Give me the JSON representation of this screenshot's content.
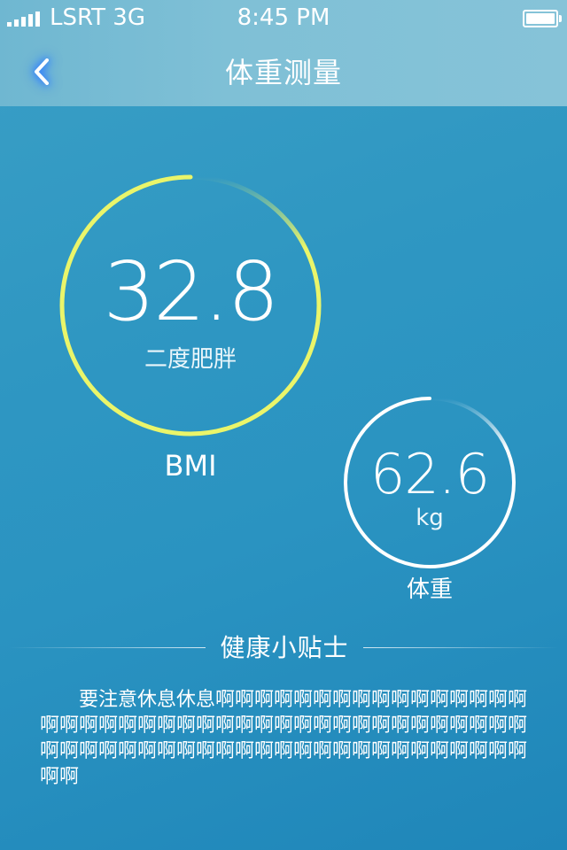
{
  "status_bar": {
    "carrier": "LSRT 3G",
    "time": "8:45 PM",
    "signal_icon": "signal-bars-icon",
    "battery_icon": "battery-full-icon"
  },
  "nav": {
    "title": "体重测量",
    "back_icon": "chevron-left-icon"
  },
  "bmi": {
    "value": "32.8",
    "status": "二度肥胖",
    "label": "BMI",
    "ring_color": "#eaf56a"
  },
  "weight": {
    "value": "62.6",
    "unit": "kg",
    "label": "体重",
    "ring_color": "#ffffff"
  },
  "tips": {
    "title": "健康小贴士",
    "body": "要注意休息休息啊啊啊啊啊啊啊啊啊啊啊啊啊啊啊啊啊啊啊啊啊啊啊啊啊啊啊啊啊啊啊啊啊啊啊啊啊啊啊啊啊啊啊啊啊啊啊啊啊啊啊啊啊啊啊啊啊啊啊啊啊啊啊啊啊啊啊啊"
  },
  "colors": {
    "background": "#2f97c2",
    "header": "#7fc0d6",
    "back_glow": "#2d7cff"
  }
}
